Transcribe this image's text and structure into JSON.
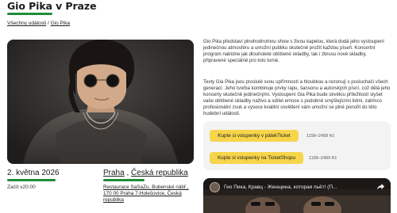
{
  "page": {
    "title": "Gio Pika v Praze"
  },
  "breadcrumb": {
    "root": "Všechny události",
    "sep": " / ",
    "current": "Gio Pika"
  },
  "event": {
    "date": "2. května 2026",
    "start_label": "Začít v20:00",
    "city": "Praha",
    "country": "Česká republika",
    "location_sep": " , ",
    "address": "Restaurace SaSaZu, Bubenské nábř., 170 00 Praha 7-Holešovice, Česká republika"
  },
  "description": {
    "p1": "Gio Pika představí plnohodnotnou show s živou kapelou, která dodá jeho vystoupení jedinečnou atmosféru a umožní publiku skutečně prožít každou píseň. Koncertní program nabídne jak dlouholeté oblíbené skladby, tak i zbrusu nové skladby, připravené speciálně pro toto turné.",
    "p2": "Texty Gia Pika jsou proslulé svou upřímností a hloubkou a rezonují s posluchači všech generací. Jeho tvorba kombinuje prvky rapu, šansonu a autorských písní, což dělá jeho koncerty skutečně jedinečnými. Vystoupení Gia Pika bude skvělou příležitostí slyšet vaše oblíbené skladby naživo a sdílet emoce s podobně smýšlejícími lidmi, zatímco profesionální zvuk a vysoce kvalitní osvětlení vám umožní se plně ponořit do této hudební události."
  },
  "tickets": [
    {
      "label": "Kupte si vstupenky v pátekTicket",
      "price": "1199–2499 Kč"
    },
    {
      "label": "Kupte si vstupenky na TicketShopu",
      "price": "1199–2499 Kč"
    }
  ],
  "video": {
    "title": "Гио Пика, Кравц - Женщина, которая пьёт! (П..."
  },
  "colors": {
    "accent": "#1f8c3a",
    "button": "#f7d54a",
    "panel": "#f3f3f3"
  }
}
